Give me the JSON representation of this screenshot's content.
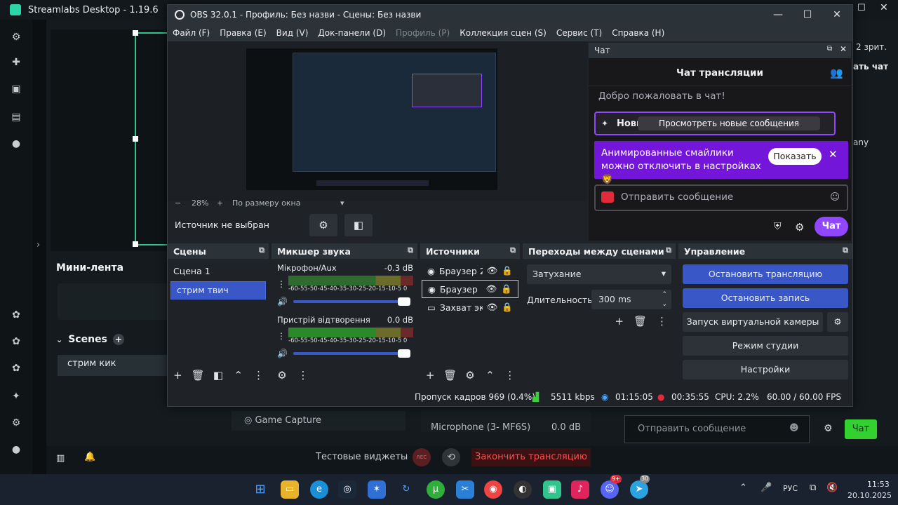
{
  "streamlabs": {
    "title": "Streamlabs Desktop - 1.19.6",
    "sidebar_icons": [
      "gear-icon",
      "puzzle-icon",
      "store-icon",
      "layers-icon",
      "play-icon",
      "discord-icon",
      "chart-icon",
      "integration-icon",
      "sparkle-icon",
      "settings-icon",
      "user-icon"
    ],
    "mini_feed": "Мини-лента",
    "scenes_label": "Scenes",
    "scene_item": "стрим кик",
    "game_capture": "Game Capture",
    "mic_label": "Microphone (3- MF6S)",
    "mic_value": "0.0 dB",
    "test_widgets": "Тестовые виджеты",
    "rec_label": "REC",
    "end_stream": "Закончить трансляцию",
    "chat_placeholder": "Отправить сообщение",
    "chat_button": "Чат",
    "right_fragment1": "2 зрит.",
    "right_fragment2": "ать чат",
    "right_fragment3": "any"
  },
  "obs": {
    "title": "OBS 32.0.1 - Профиль: Без назви - Сцены: Без назви",
    "menu": [
      "Файл (F)",
      "Правка (E)",
      "Вид (V)",
      "Док-панели (D)",
      "Профиль (P)",
      "Коллекция сцен (S)",
      "Сервис (T)",
      "Справка (H)"
    ],
    "zoom": "28%",
    "fit": "По размеру окна",
    "no_source": "Источник не выбран",
    "chat": {
      "dock_title": "Чат",
      "title": "Чат трансляции",
      "welcome": "Добро пожаловать в чат!",
      "pinned": "Новые пол...",
      "new_messages": "Просмотреть новые сообщения",
      "notice": "Анимированные смайлики можно отключить в настройках 🦁",
      "show": "Показать",
      "input_placeholder": "Отправить сообщение",
      "send": "Чат"
    },
    "scenes": {
      "title": "Сцены",
      "items": [
        "Сцена 1",
        "стрим твич"
      ]
    },
    "mixer": {
      "title": "Микшер звука",
      "channels": [
        {
          "name": "Мікрофон/Aux",
          "db": "-0.3 dB",
          "scale": "-60-55-50-45-40-35-30-25-20-15-10-5 0"
        },
        {
          "name": "Пристрій відтворення",
          "db": "0.0 dB",
          "scale": "-60-55-50-45-40-35-30-25-20-15-10-5 0"
        }
      ]
    },
    "sources": {
      "title": "Источники",
      "items": [
        "Браузер 2",
        "Браузер",
        "Захват эк"
      ]
    },
    "transitions": {
      "title": "Переходы между сценами",
      "selected": "Затухание",
      "duration_label": "Длительность",
      "duration_value": "300 ms"
    },
    "controls": {
      "title": "Управление",
      "buttons": [
        "Остановить трансляцию",
        "Остановить запись",
        "Запуск виртуальной камеры",
        "Режим студии",
        "Настройки"
      ]
    },
    "status": {
      "dropped": "Пропуск кадров 969 (0.4%)",
      "kbps": "5511 kbps",
      "stream_time": "01:15:05",
      "rec_time": "00:35:55",
      "cpu": "CPU: 2.2%",
      "fps": "60.00 / 60.00 FPS"
    }
  },
  "taskbar": {
    "lang": "РУС",
    "time": "11:53",
    "date": "20.10.2025",
    "badge": "9+",
    "badge2": "30"
  },
  "colors": {
    "accent": "#3a57c8",
    "twitch": "#9147ff",
    "live": "#e22b3a",
    "sl_green": "#31c48d"
  }
}
